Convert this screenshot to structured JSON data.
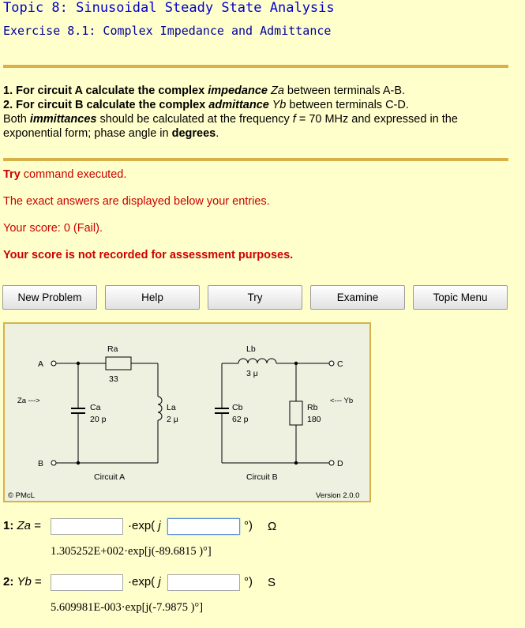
{
  "header": {
    "title": "Topic 8: Sinusoidal Steady State Analysis",
    "subtitle": "Exercise 8.1: Complex Impedance and Admittance"
  },
  "question": {
    "l1_a": "1. For circuit A calculate the complex ",
    "l1_b": "impedance",
    "l1_c": " Za",
    "l1_d": " between terminals A-B.",
    "l2_a": "2. For circuit B calculate the complex ",
    "l2_b": "admittance",
    "l2_c": " Yb",
    "l2_d": " between terminals C-D.",
    "l3_a": "Both ",
    "l3_b": "immittances",
    "l3_c": " should be calculated at the frequency ",
    "l3_d": "f",
    "l3_e": " = 70 MHz and expressed in the exponential form; phase angle in ",
    "l3_f": "degrees",
    "l3_g": "."
  },
  "status": {
    "try_word": "Try",
    "try_rest": " command executed.",
    "exact": "The exact answers are displayed below your entries.",
    "score": "Your score: 0 (Fail).",
    "not_recorded": "Your score is not recorded for assessment purposes."
  },
  "buttons": {
    "new_problem": "New Problem",
    "help": "Help",
    "try": "Try",
    "examine": "Examine",
    "topic_menu": "Topic Menu"
  },
  "figure": {
    "ra": "Ra",
    "ra_val": "33",
    "ca": "Ca",
    "ca_val": "20 p",
    "la": "La",
    "la_val": "2 μ",
    "lb": "Lb",
    "lb_val": "3 μ",
    "cb": "Cb",
    "cb_val": "62 p",
    "rb": "Rb",
    "rb_val": "180",
    "term_a": "A",
    "term_b": "B",
    "term_c": "C",
    "term_d": "D",
    "za_arrow": "Za --->",
    "yb_arrow": "<--- Yb",
    "circuit_a": "Circuit A",
    "circuit_b": "Circuit B",
    "copyright": "© PMcL",
    "version": "Version 2.0.0"
  },
  "answers": {
    "q1_num": "1: ",
    "q1_var": "Za",
    "q1_eq": " =",
    "q2_num": "2: ",
    "q2_var": "Yb",
    "q2_eq": " =",
    "exp_prefix": "·exp( ",
    "exp_j": "j",
    "deg_close": "°)",
    "ohm": "Ω",
    "siemens": "S",
    "za_magnitude": "",
    "za_phase": "",
    "yb_magnitude": "",
    "yb_phase": "",
    "za_exact": "1.305252E+002·exp[j(-89.6815 )°]",
    "yb_exact": "5.609981E-003·exp[j(-7.9875 )°]"
  }
}
